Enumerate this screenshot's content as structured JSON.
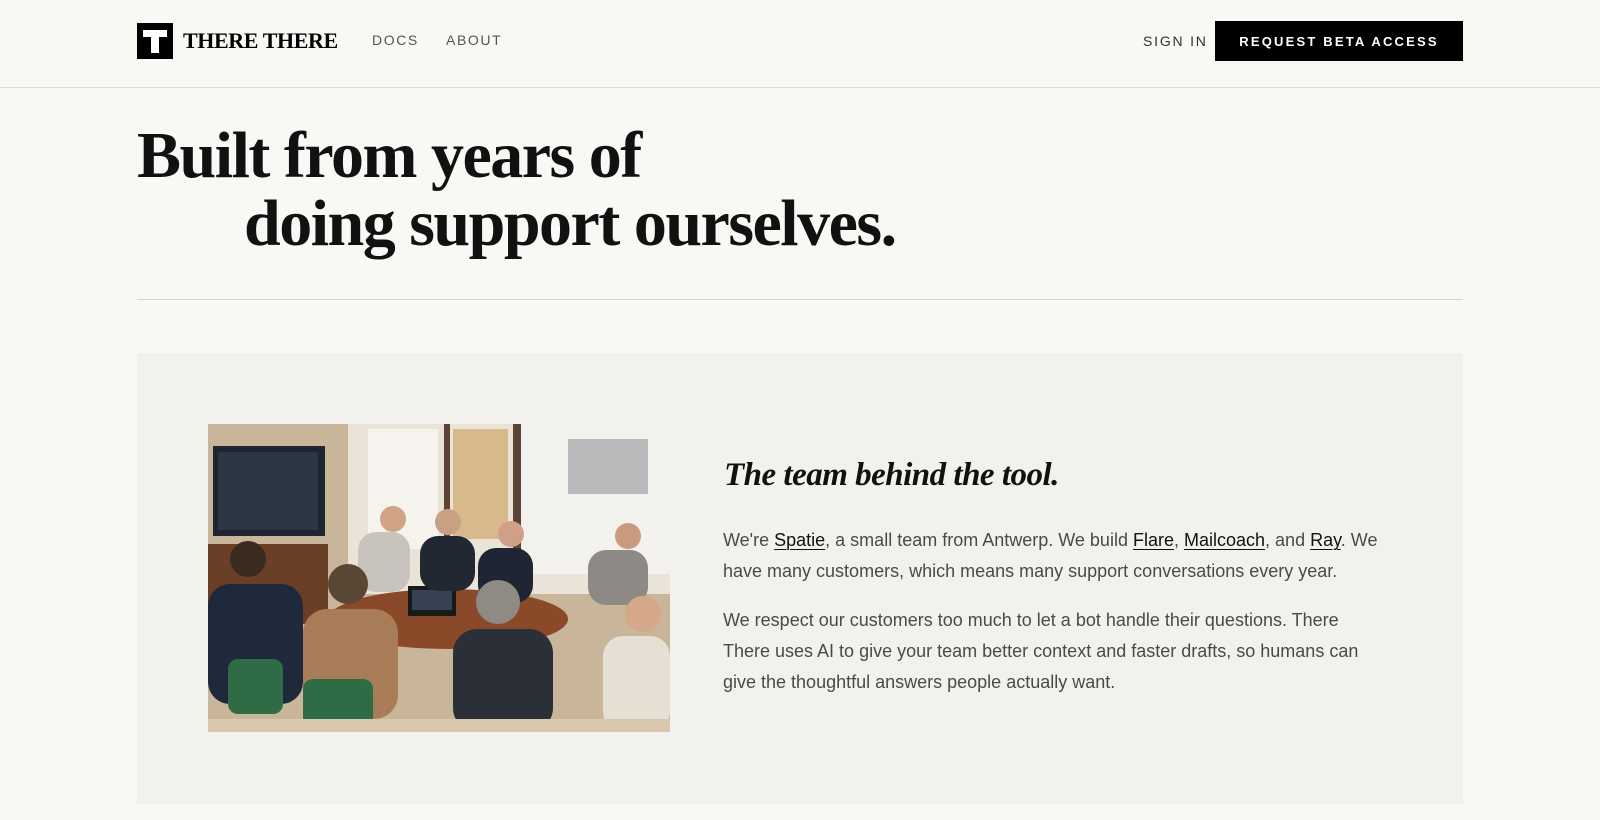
{
  "header": {
    "logo_text": "THERE THERE",
    "nav": {
      "docs": "DOCS",
      "about": "ABOUT"
    },
    "sign_in": "SIGN IN",
    "cta": "REQUEST BETA ACCESS"
  },
  "hero": {
    "line1": "Built from years of",
    "line2": "doing support ourselves."
  },
  "team": {
    "heading": "The team behind the tool.",
    "p1": {
      "t1": "We're ",
      "link_spatie": "Spatie",
      "t2": ", a small team from Antwerp. We build ",
      "link_flare": "Flare",
      "t3": ", ",
      "link_mailcoach": "Mailcoach",
      "t4": ", and ",
      "link_ray": "Ray",
      "t5": ". We have many customers, which means many support conversations every year."
    },
    "p2": "We respect our customers too much to let a bot handle their questions. There There uses AI to give your team better context and faster drafts, so humans can give the thoughtful answers people actually want."
  },
  "colors": {
    "background": "#f9f8f5",
    "panel": "#f2f1ed",
    "accent": "#000000"
  }
}
